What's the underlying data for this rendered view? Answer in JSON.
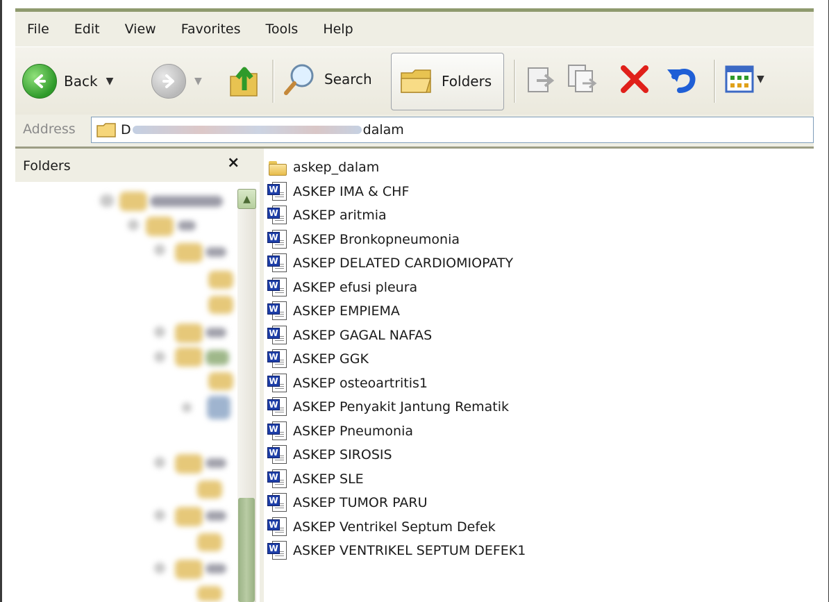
{
  "menu": [
    "File",
    "Edit",
    "View",
    "Favorites",
    "Tools",
    "Help"
  ],
  "toolbar": {
    "back_label": "Back",
    "search_label": "Search",
    "folders_label": "Folders"
  },
  "address": {
    "label": "Address",
    "path_start": "D",
    "path_end": "dalam"
  },
  "folders_pane": {
    "title": "Folders",
    "close_glyph": "×"
  },
  "files": [
    {
      "name": "askep_dalam",
      "icon": "folder-icon"
    },
    {
      "name": "ASKEP  IMA & CHF",
      "icon": "word-doc-icon"
    },
    {
      "name": "ASKEP aritmia",
      "icon": "word-doc-icon"
    },
    {
      "name": "ASKEP Bronkopneumonia",
      "icon": "word-doc-icon"
    },
    {
      "name": "ASKEP DELATED CARDIOMIOPATY",
      "icon": "word-doc-icon"
    },
    {
      "name": "ASKEP efusi pleura",
      "icon": "word-doc-icon"
    },
    {
      "name": "ASKEP EMPIEMA",
      "icon": "word-doc-icon"
    },
    {
      "name": "ASKEP GAGAL NAFAS",
      "icon": "word-doc-icon"
    },
    {
      "name": "ASKEP GGK",
      "icon": "word-doc-icon"
    },
    {
      "name": "ASKEP osteoartritis1",
      "icon": "word-doc-icon"
    },
    {
      "name": "ASKEP Penyakit Jantung Rematik",
      "icon": "word-doc-icon"
    },
    {
      "name": "ASKEP Pneumonia",
      "icon": "word-doc-icon"
    },
    {
      "name": "ASKEP SIROSIS",
      "icon": "word-doc-icon"
    },
    {
      "name": "ASKEP SLE",
      "icon": "word-doc-icon"
    },
    {
      "name": "ASKEP TUMOR PARU",
      "icon": "word-doc-icon"
    },
    {
      "name": "ASKEP Ventrikel Septum Defek",
      "icon": "word-doc-icon"
    },
    {
      "name": "ASKEP VENTRIKEL SEPTUM DEFEK1",
      "icon": "word-doc-icon"
    }
  ],
  "colors": {
    "chrome": "#efeee4",
    "delete_red": "#e0201a",
    "undo_blue": "#1f5fd6"
  }
}
